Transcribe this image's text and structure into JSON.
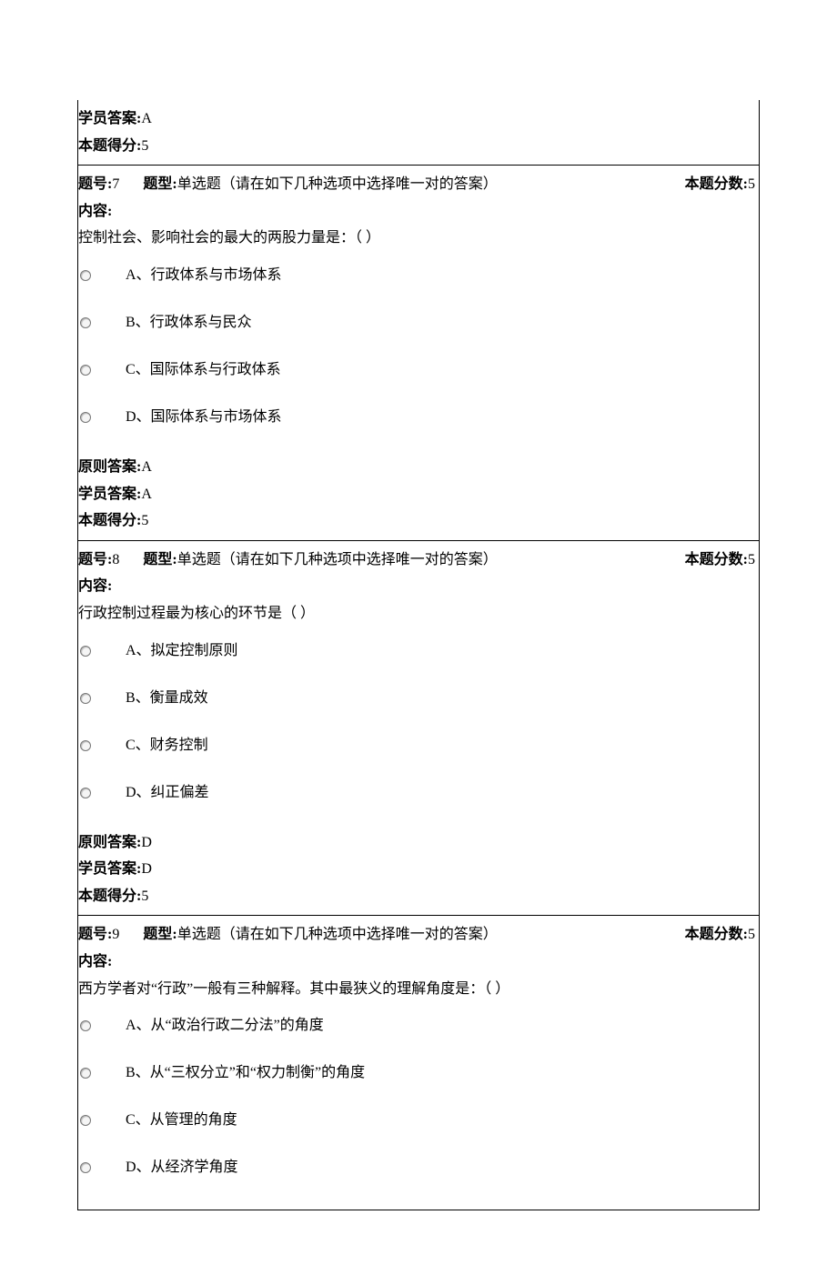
{
  "labels": {
    "qnum_prefix": "题号:",
    "qtype_prefix": "题型:",
    "qscore_prefix": "本题分数:",
    "content_label": "内容:",
    "ref_answer_label": "原则答案:",
    "user_answer_label": "学员答案:",
    "score_earned_label": "本题得分:"
  },
  "prev": {
    "user_answer": "A",
    "score_earned": "5"
  },
  "questions": [
    {
      "num": "7",
      "type": "单选题（请在如下几种选项中选择唯一对的答案）",
      "score": "5",
      "stem": "控制社会、影响社会的最大的两股力量是：（ ）",
      "options": [
        "A、行政体系与市场体系",
        "B、行政体系与民众",
        "C、国际体系与行政体系",
        "D、国际体系与市场体系"
      ],
      "ref_answer": "A",
      "user_answer": "A",
      "score_earned": "5"
    },
    {
      "num": "8",
      "type": "单选题（请在如下几种选项中选择唯一对的答案）",
      "score": "5",
      "stem": "行政控制过程最为核心的环节是（ ）",
      "options": [
        "A、拟定控制原则",
        "B、衡量成效",
        "C、财务控制",
        "D、纠正偏差"
      ],
      "ref_answer": "D",
      "user_answer": "D",
      "score_earned": "5"
    },
    {
      "num": "9",
      "type": "单选题（请在如下几种选项中选择唯一对的答案）",
      "score": "5",
      "stem": "西方学者对“行政”一般有三种解释。其中最狭义的理解角度是：（ ）",
      "options": [
        "A、从“政治行政二分法”的角度",
        "B、从“三权分立”和“权力制衡”的角度",
        "C、从管理的角度",
        "D、从经济学角度"
      ]
    }
  ]
}
